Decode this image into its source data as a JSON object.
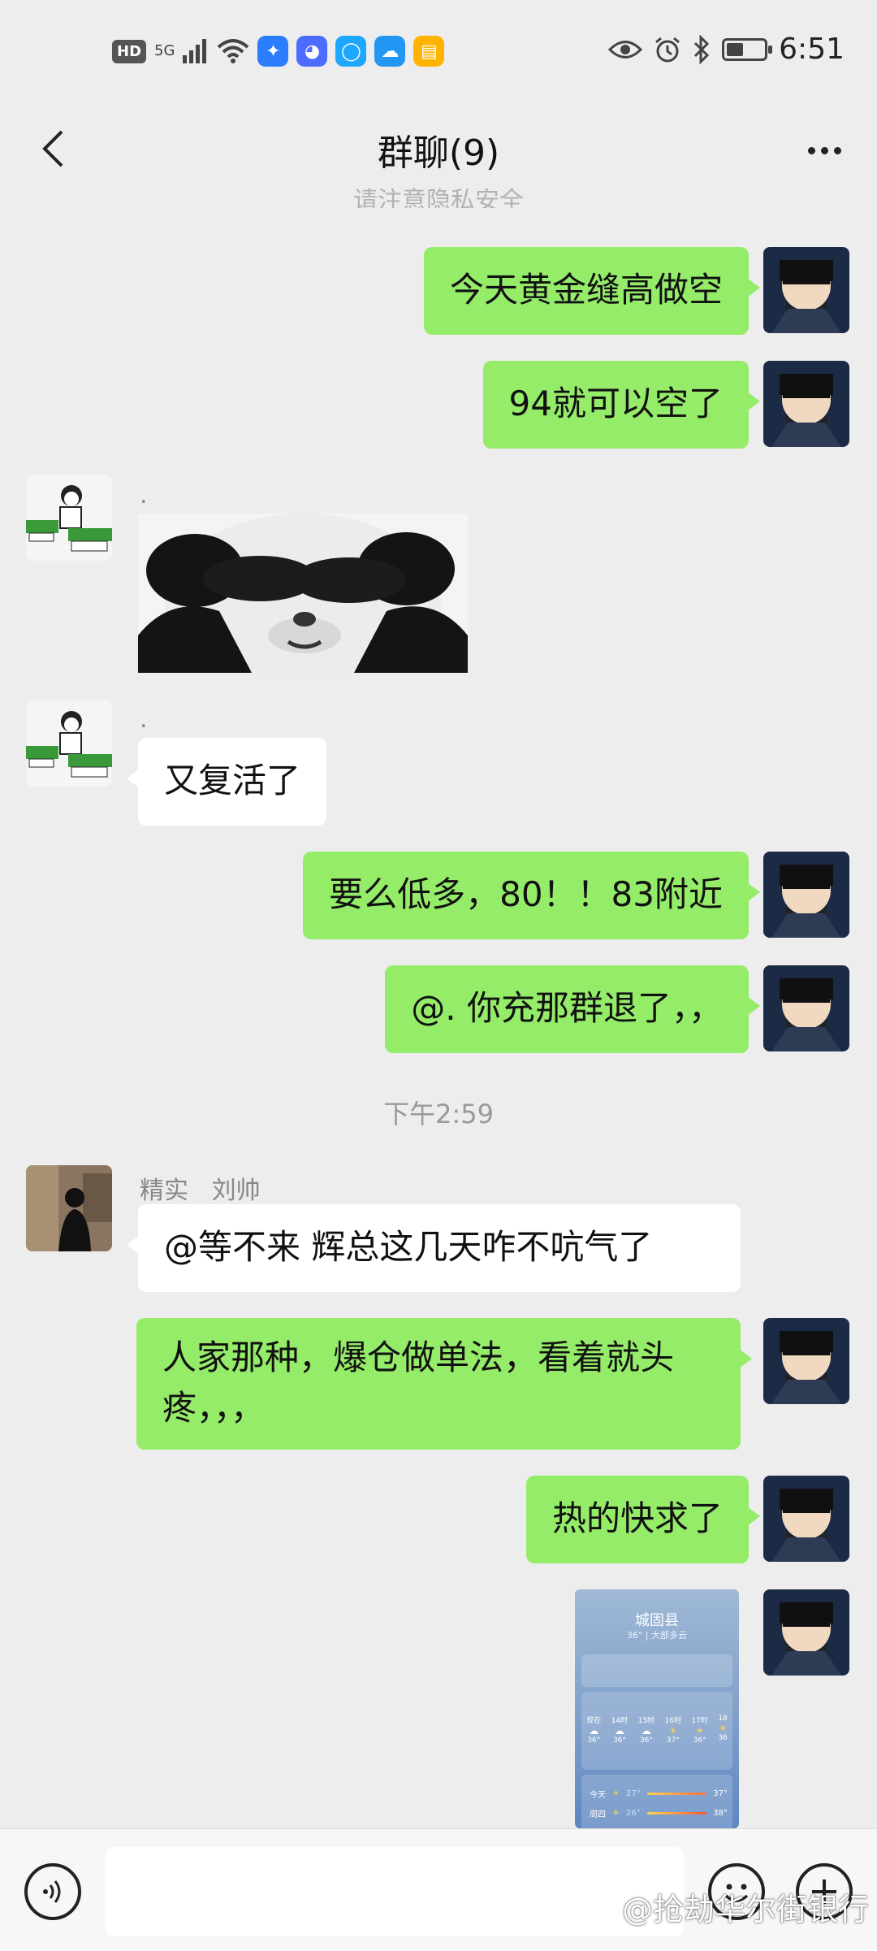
{
  "status_bar": {
    "hd": "HD",
    "network": "5G",
    "time": "6:51"
  },
  "header": {
    "title": "群聊(9)"
  },
  "notice": "请注意隐私安全",
  "messages": [
    {
      "side": "me",
      "text": "今天黄金缝高做空"
    },
    {
      "side": "me",
      "text": "94就可以空了"
    },
    {
      "side": "other",
      "sender": ".",
      "type": "sticker",
      "sticker": "panda-meme"
    },
    {
      "side": "other",
      "sender": ".",
      "text": "又复活了"
    },
    {
      "side": "me",
      "text": "要么低多，80！！83附近"
    },
    {
      "side": "me",
      "text": "@. 你充那群退了，，"
    },
    {
      "type": "time",
      "text": "下午2:59"
    },
    {
      "side": "other",
      "sender": "精实   刘帅",
      "text": "@等不来  辉总这几天咋不吭气了"
    },
    {
      "side": "me",
      "text": "人家那种，爆仓做单法，看着就头疼，，，"
    },
    {
      "side": "me",
      "text": "热的快求了"
    },
    {
      "side": "me",
      "type": "image",
      "image": {
        "location": "城固县",
        "summary": "36° | 大部多云",
        "hours": [
          "现在",
          "14时",
          "15时",
          "16时",
          "17时",
          "18"
        ],
        "hour_temps": [
          "36°",
          "36°",
          "36°",
          "37°",
          "36°",
          "36"
        ],
        "days": [
          {
            "day": "今天",
            "low": "27°",
            "high": "37°"
          },
          {
            "day": "周四",
            "low": "26°",
            "high": "38°"
          }
        ]
      }
    }
  ],
  "input_bar": {
    "watermark": "@抢劫华尔街银行"
  },
  "colors": {
    "bubble_me": "#95ec69",
    "bubble_other": "#ffffff",
    "background": "#ededed"
  }
}
